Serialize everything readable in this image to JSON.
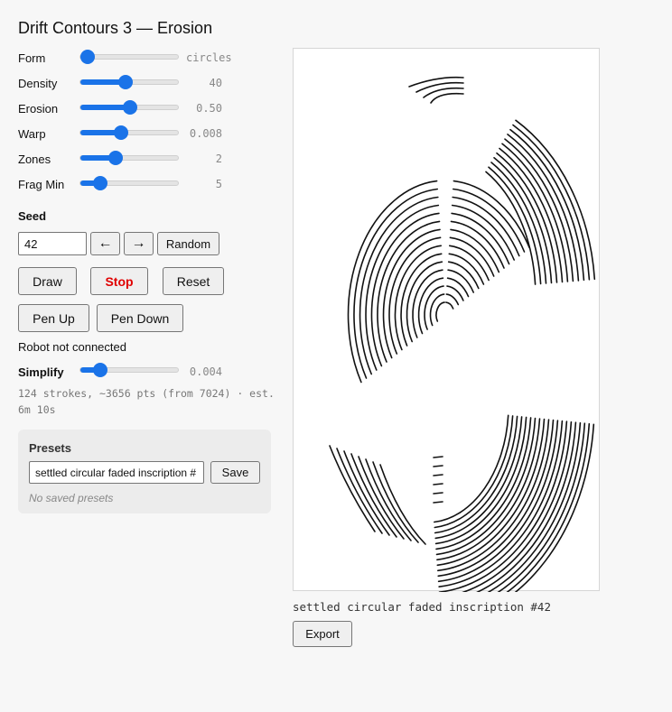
{
  "app": {
    "title": "Drift Contours 3 — Erosion"
  },
  "sliders": [
    {
      "label": "Form",
      "value": "circles",
      "fraction": 0.0
    },
    {
      "label": "Density",
      "value": "40",
      "fraction": 0.45
    },
    {
      "label": "Erosion",
      "value": "0.50",
      "fraction": 0.5
    },
    {
      "label": "Warp",
      "value": "0.008",
      "fraction": 0.41
    },
    {
      "label": "Zones",
      "value": "2",
      "fraction": 0.35
    },
    {
      "label": "Frag Min",
      "value": "5",
      "fraction": 0.2
    }
  ],
  "seed": {
    "label": "Seed",
    "value": "42",
    "prev_label": "←",
    "next_label": "→",
    "random_label": "Random"
  },
  "actions": {
    "draw": "Draw",
    "stop": "Stop",
    "reset": "Reset",
    "pen_up": "Pen Up",
    "pen_down": "Pen Down"
  },
  "status": {
    "robot": "Robot not connected"
  },
  "simplify": {
    "label": "Simplify",
    "value": "0.004",
    "fraction": 0.2
  },
  "stats": {
    "text": "124 strokes, ~3656 pts (from 7024) · est. 6m 10s"
  },
  "presets": {
    "title": "Presets",
    "name_value": "settled circular faded inscription #",
    "save_label": "Save",
    "empty_text": "No saved presets"
  },
  "canvas": {
    "caption": "settled circular faded inscription #42",
    "export_label": "Export"
  },
  "colors": {
    "accent": "#1a73e8",
    "stop": "#e00000",
    "stroke": "#111111"
  }
}
